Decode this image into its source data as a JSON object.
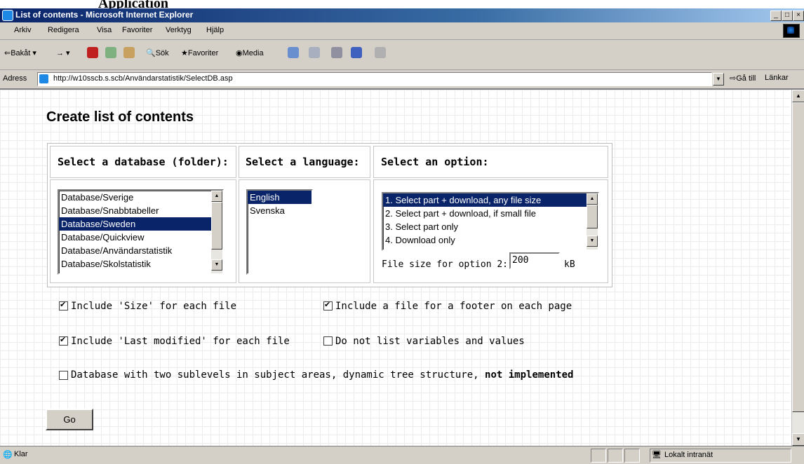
{
  "doc_heading": "Application",
  "window": {
    "title": "List of contents - Microsoft Internet Explorer",
    "min": "_",
    "max": "□",
    "close": "×"
  },
  "menu": [
    "Arkiv",
    "Redigera",
    "Visa",
    "Favoriter",
    "Verktyg",
    "Hjälp"
  ],
  "toolbar": {
    "back": "Bakåt",
    "search": "Sök",
    "favorites": "Favoriter",
    "media": "Media"
  },
  "address": {
    "label": "Adress",
    "url": "http://w10sscb.s.scb/Användarstatistik/SelectDB.asp",
    "go": "Gå till",
    "links": "Länkar"
  },
  "page": {
    "title": "Create list of contents",
    "database": {
      "header": "Select a database (folder):",
      "options": [
        "Database/Sverige",
        "Database/Snabbtabeller",
        "Database/Sweden",
        "Database/Quickview",
        "Database/Användarstatistik",
        "Database/Skolstatistik"
      ],
      "selected_index": 2
    },
    "language": {
      "header": "Select a language:",
      "options": [
        "English",
        "Svenska"
      ],
      "selected_index": 0
    },
    "option": {
      "header": "Select an option:",
      "options": [
        "1. Select part + download, any file size",
        "2. Select part + download, if small file",
        "3. Select part only",
        "4. Download only"
      ],
      "selected_index": 0,
      "filesize_label": "File size for option 2:",
      "filesize_value": "200",
      "filesize_unit": "kB"
    },
    "checkboxes": {
      "size": {
        "label": "Include 'Size' for each file",
        "checked": true
      },
      "footer": {
        "label": "Include a file for a footer on each page",
        "checked": true
      },
      "last_modified": {
        "label": "Include 'Last modified' for each file",
        "checked": true
      },
      "no_vars": {
        "label": "Do not list variables and values",
        "checked": false
      },
      "two_sublevels": {
        "label": "Database with two sublevels in subject areas, dynamic tree structure,",
        "bold_suffix": "not implemented",
        "checked": false
      }
    },
    "go_button": "Go"
  },
  "status": {
    "left": "Klar",
    "zone": "Lokalt intranät"
  }
}
